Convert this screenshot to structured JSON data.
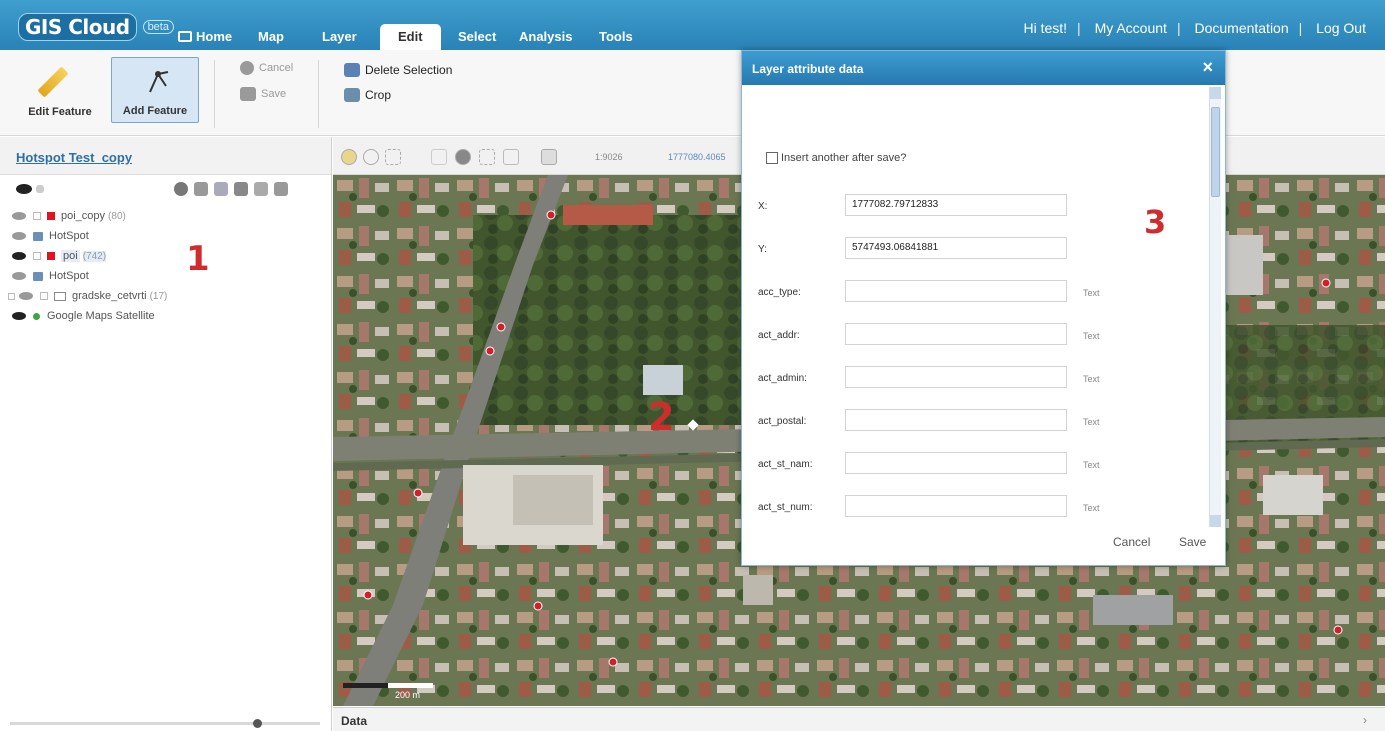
{
  "app": {
    "logo": "GIS Cloud",
    "logo_badge": "beta",
    "nav": [
      "Home",
      "Map",
      "Layer",
      "Edit",
      "Select",
      "Analysis",
      "Tools"
    ],
    "active_tab": "Edit",
    "top_links": [
      "Hi test!",
      "My Account",
      "Documentation",
      "Log Out"
    ]
  },
  "ribbon": {
    "edit_feature": "Edit Feature",
    "add_feature": "Add Feature",
    "cancel": "Cancel",
    "save": "Save",
    "delete_selection": "Delete Selection",
    "crop": "Crop"
  },
  "left_panel": {
    "title": "Hotspot Test_copy",
    "layers": [
      {
        "name": "poi_copy",
        "count": "(80)"
      },
      {
        "name": "HotSpot",
        "count": ""
      },
      {
        "name": "poi",
        "count": "(742)"
      },
      {
        "name": "HotSpot",
        "count": ""
      },
      {
        "name": "gradske_cetvrti",
        "count": "(17)"
      },
      {
        "name": "Google Maps Satellite",
        "count": ""
      }
    ],
    "annotation": "1"
  },
  "map_toolbar": {
    "scale": "1:9026",
    "coords": "1777080.4065"
  },
  "map": {
    "annotation": "2",
    "scale_text": "200 m"
  },
  "footer": {
    "title": "Data",
    "arrow": "›"
  },
  "dialog": {
    "title": "Layer attribute data",
    "close": "×",
    "insert_label": "Insert another after save?",
    "annotation": "3",
    "fields": [
      {
        "label": "X:",
        "value": "1777082.79712833",
        "type": ""
      },
      {
        "label": "Y:",
        "value": "5747493.06841881",
        "type": ""
      },
      {
        "label": "acc_type:",
        "value": "",
        "type": "Text"
      },
      {
        "label": "act_addr:",
        "value": "",
        "type": "Text"
      },
      {
        "label": "act_admin:",
        "value": "",
        "type": "Text"
      },
      {
        "label": "act_postal:",
        "value": "",
        "type": "Text"
      },
      {
        "label": "act_st_nam:",
        "value": "",
        "type": "Text"
      },
      {
        "label": "act_st_num:",
        "value": "",
        "type": "Text"
      }
    ],
    "cancel": "Cancel",
    "save": "Save"
  },
  "colors": {
    "brand_blue": "#2a82b6",
    "annotation_red": "#cf2d2d",
    "poi_red": "#e2131f"
  }
}
